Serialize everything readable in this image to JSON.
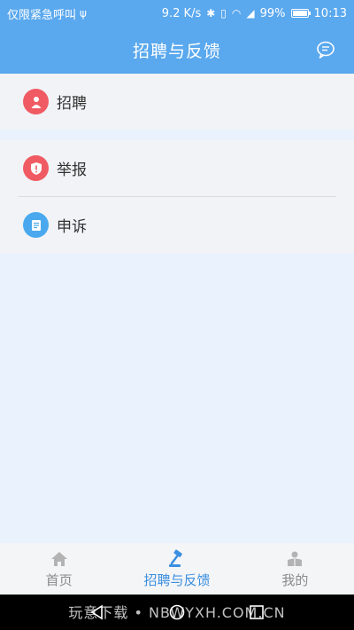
{
  "status_bar": {
    "carrier": "仅限紧急呼叫",
    "speed": "9.2 K/s",
    "battery": "99%",
    "battery_level": 0.99,
    "time": "10:13"
  },
  "header": {
    "title": "招聘与反馈"
  },
  "menu": [
    {
      "label": "招聘",
      "icon": "recruit-icon",
      "color": "#f05a62"
    },
    {
      "label": "举报",
      "icon": "report-icon",
      "color": "#f05a62"
    },
    {
      "label": "申诉",
      "icon": "appeal-icon",
      "color": "#4aa9ee"
    }
  ],
  "tabs": [
    {
      "label": "首页",
      "icon": "home-icon",
      "active": false
    },
    {
      "label": "招聘与反馈",
      "icon": "gavel-icon",
      "active": true
    },
    {
      "label": "我的",
      "icon": "profile-icon",
      "active": false
    }
  ],
  "watermark": "玩意下载 • NBWYXH.COM.CN",
  "colors": {
    "primary": "#5aa8ee",
    "active_tab": "#3a8fe0",
    "danger": "#f05a62"
  }
}
